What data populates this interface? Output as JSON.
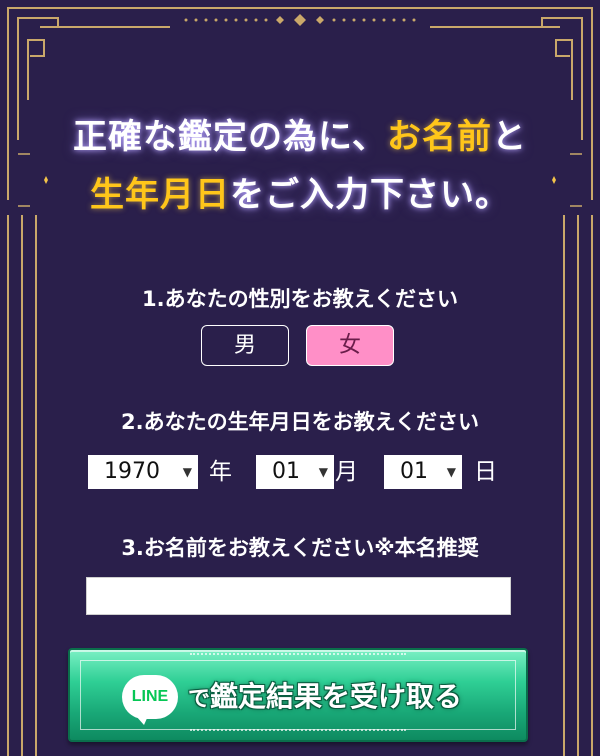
{
  "header": {
    "line1_prefix": "正確な鑑定の為に、",
    "line1_accent": "お名前",
    "line1_suffix": "と",
    "line2_accent": "生年月日",
    "line2_suffix": "をご入力下さい。"
  },
  "questions": {
    "gender": "1.あなたの性別をお教えください",
    "birthday": "2.あなたの生年月日をお教えください",
    "name": "3.お名前をお教えください※本名推奨"
  },
  "gender": {
    "male": "男",
    "female": "女",
    "selected": "女"
  },
  "birthday": {
    "year": "1970",
    "year_unit": "年",
    "month": "01",
    "month_unit": "月",
    "day": "01",
    "day_unit": "日"
  },
  "name_input": {
    "value": "",
    "placeholder": ""
  },
  "cta": {
    "logo": "LINE",
    "prefix": "で",
    "label": "鑑定結果を受け取る"
  },
  "colors": {
    "background": "#2a1f4b",
    "gold": "#c9a86a",
    "accent_yellow": "#ffc61a",
    "selected_pink": "#ff8fc7",
    "cta_green": "#19a877"
  },
  "icons": [
    "crescent-moon-icon",
    "line-logo-icon",
    "chevron-down-icon"
  ]
}
